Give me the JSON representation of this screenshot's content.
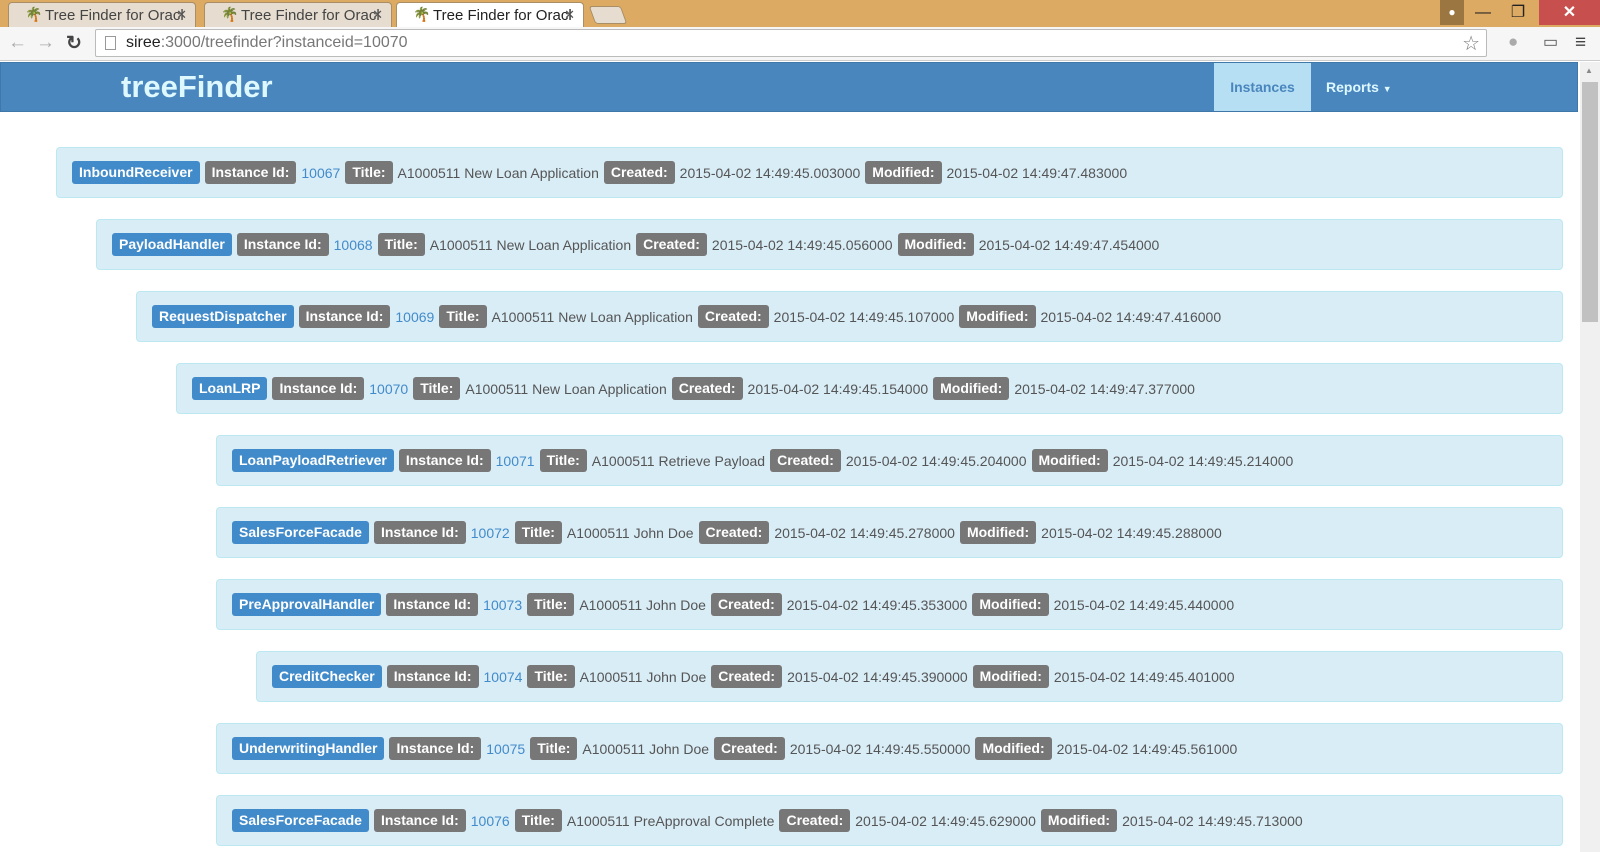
{
  "browser": {
    "tabs": [
      "Tree Finder for Oracl",
      "Tree Finder for Oracl",
      "Tree Finder for Oracl"
    ],
    "url_host": "siree",
    "url_rest": ":3000/treefinder?instanceid=10070"
  },
  "navbar": {
    "brand": "treeFinder",
    "instances": "Instances",
    "reports": "Reports"
  },
  "labels": {
    "instance_id": "Instance Id:",
    "title": "Title:",
    "created": "Created:",
    "modified": "Modified:"
  },
  "rows": [
    {
      "name": "InboundReceiver",
      "level": 0,
      "id": "10067",
      "title": "A1000511 New Loan Application",
      "created": "2015-04-02 14:49:45.003000",
      "modified": "2015-04-02 14:49:47.483000"
    },
    {
      "name": "PayloadHandler",
      "level": 1,
      "id": "10068",
      "title": "A1000511 New Loan Application",
      "created": "2015-04-02 14:49:45.056000",
      "modified": "2015-04-02 14:49:47.454000"
    },
    {
      "name": "RequestDispatcher",
      "level": 2,
      "id": "10069",
      "title": "A1000511 New Loan Application",
      "created": "2015-04-02 14:49:45.107000",
      "modified": "2015-04-02 14:49:47.416000"
    },
    {
      "name": "LoanLRP",
      "level": 3,
      "id": "10070",
      "title": "A1000511 New Loan Application",
      "created": "2015-04-02 14:49:45.154000",
      "modified": "2015-04-02 14:49:47.377000"
    },
    {
      "name": "LoanPayloadRetriever",
      "level": 4,
      "id": "10071",
      "title": "A1000511 Retrieve Payload",
      "created": "2015-04-02 14:49:45.204000",
      "modified": "2015-04-02 14:49:45.214000"
    },
    {
      "name": "SalesForceFacade",
      "level": 4,
      "id": "10072",
      "title": "A1000511 John Doe",
      "created": "2015-04-02 14:49:45.278000",
      "modified": "2015-04-02 14:49:45.288000"
    },
    {
      "name": "PreApprovalHandler",
      "level": 4,
      "id": "10073",
      "title": "A1000511 John Doe",
      "created": "2015-04-02 14:49:45.353000",
      "modified": "2015-04-02 14:49:45.440000"
    },
    {
      "name": "CreditChecker",
      "level": 5,
      "id": "10074",
      "title": "A1000511 John Doe",
      "created": "2015-04-02 14:49:45.390000",
      "modified": "2015-04-02 14:49:45.401000"
    },
    {
      "name": "UnderwritingHandler",
      "level": 4,
      "id": "10075",
      "title": "A1000511 John Doe",
      "created": "2015-04-02 14:49:45.550000",
      "modified": "2015-04-02 14:49:45.561000"
    },
    {
      "name": "SalesForceFacade",
      "level": 4,
      "id": "10076",
      "title": "A1000511 PreApproval Complete",
      "created": "2015-04-02 14:49:45.629000",
      "modified": "2015-04-02 14:49:45.713000"
    }
  ]
}
